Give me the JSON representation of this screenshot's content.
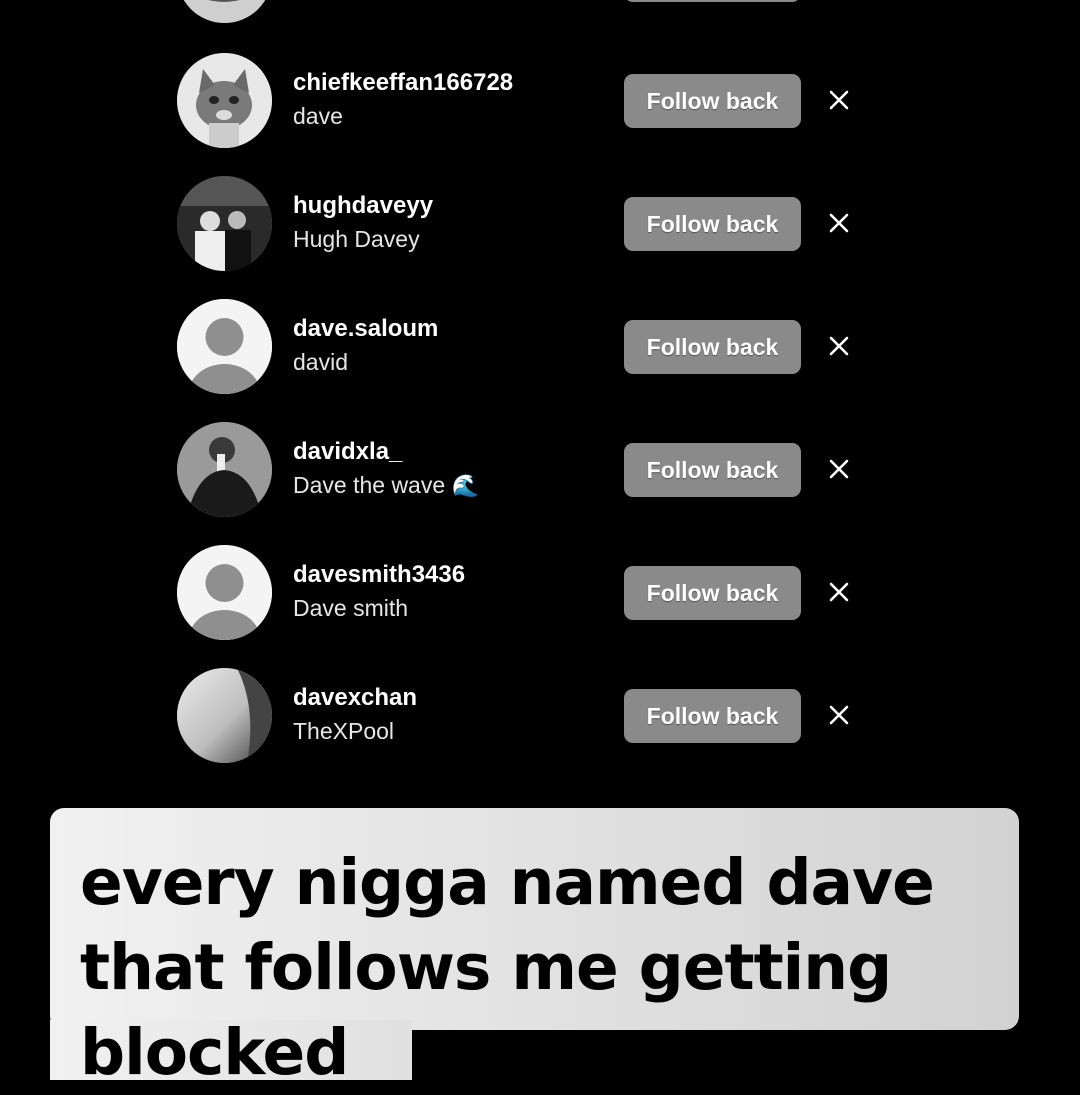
{
  "suggestions": [
    {
      "username": "chiefkeeffan166728",
      "full_name": "dave",
      "button_label": "Follow back",
      "avatar": "cat-photo"
    },
    {
      "username": "hughdaveyy",
      "full_name": "Hugh Davey",
      "button_label": "Follow back",
      "avatar": "two-people-photo"
    },
    {
      "username": "dave.saloum",
      "full_name": "david",
      "button_label": "Follow back",
      "avatar": "default-avatar-icon"
    },
    {
      "username": "davidxla_",
      "full_name": "Dave the wave",
      "full_name_emoji": "🌊",
      "button_label": "Follow back",
      "avatar": "mirror-selfie-photo"
    },
    {
      "username": "davesmith3436",
      "full_name": "Dave smith",
      "button_label": "Follow back",
      "avatar": "default-avatar-icon"
    },
    {
      "username": "davexchan",
      "full_name": "TheXPool",
      "button_label": "Follow back",
      "avatar": "blurred-photo"
    }
  ],
  "caption": "every nigga named dave that follows me getting blocked",
  "colors": {
    "background": "#000000",
    "button": "#8a8a8a",
    "caption_box": "#e6e6e6"
  }
}
